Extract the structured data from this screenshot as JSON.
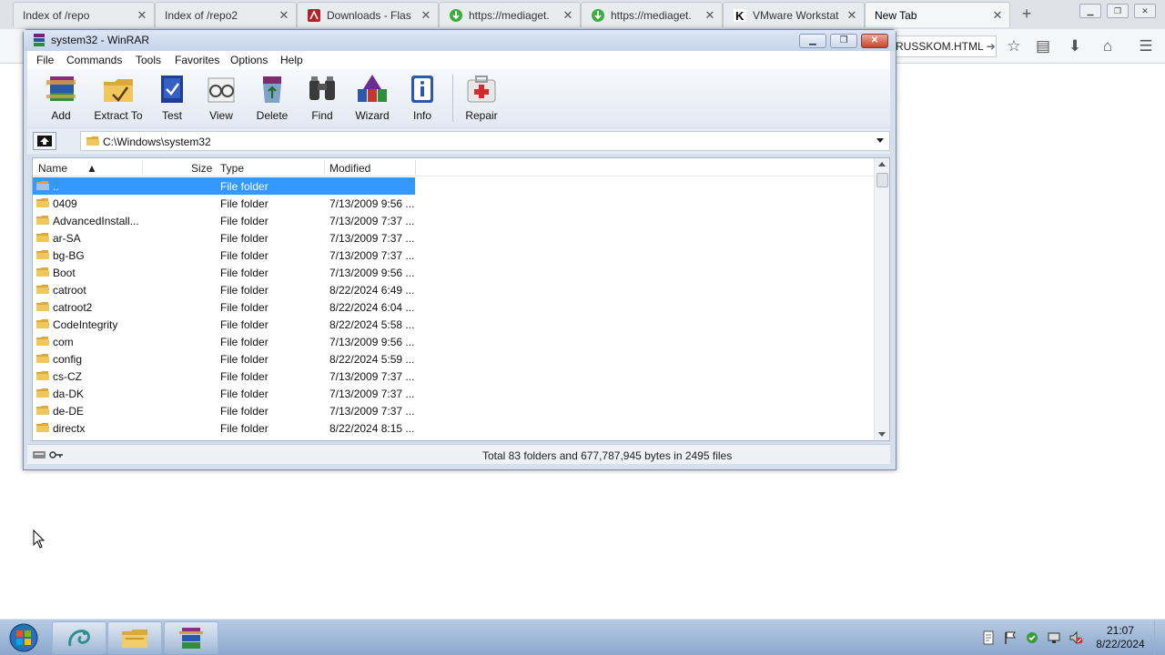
{
  "browser": {
    "tabs": [
      {
        "title": "Index of /repo",
        "icon": "none"
      },
      {
        "title": "Index of /repo2",
        "icon": "none"
      },
      {
        "title": "Downloads - Flas",
        "icon": "flash-icon"
      },
      {
        "title": "https://mediaget.",
        "icon": "mediaget-icon"
      },
      {
        "title": "https://mediaget.",
        "icon": "mediaget-icon"
      },
      {
        "title": "VMware Workstat",
        "icon": "k-icon"
      },
      {
        "title": "New Tab",
        "icon": "none",
        "active": true
      }
    ],
    "url_tail": "RUSSKOM.HTML"
  },
  "winrar": {
    "title": "system32 - WinRAR",
    "menu": [
      "File",
      "Commands",
      "Tools",
      "Favorites",
      "Options",
      "Help"
    ],
    "toolbar": [
      "Add",
      "Extract To",
      "Test",
      "View",
      "Delete",
      "Find",
      "Wizard",
      "Info",
      "Repair"
    ],
    "path": "C:\\Windows\\system32",
    "columns": {
      "name": "Name",
      "size": "Size",
      "type": "Type",
      "modified": "Modified"
    },
    "files": [
      {
        "name": "..",
        "type": "File folder",
        "modified": "",
        "selected": true
      },
      {
        "name": "0409",
        "type": "File folder",
        "modified": "7/13/2009 9:56 ..."
      },
      {
        "name": "AdvancedInstall...",
        "type": "File folder",
        "modified": "7/13/2009 7:37 ..."
      },
      {
        "name": "ar-SA",
        "type": "File folder",
        "modified": "7/13/2009 7:37 ..."
      },
      {
        "name": "bg-BG",
        "type": "File folder",
        "modified": "7/13/2009 7:37 ..."
      },
      {
        "name": "Boot",
        "type": "File folder",
        "modified": "7/13/2009 9:56 ..."
      },
      {
        "name": "catroot",
        "type": "File folder",
        "modified": "8/22/2024 6:49 ..."
      },
      {
        "name": "catroot2",
        "type": "File folder",
        "modified": "8/22/2024 6:04 ..."
      },
      {
        "name": "CodeIntegrity",
        "type": "File folder",
        "modified": "8/22/2024 5:58 ..."
      },
      {
        "name": "com",
        "type": "File folder",
        "modified": "7/13/2009 9:56 ..."
      },
      {
        "name": "config",
        "type": "File folder",
        "modified": "8/22/2024 5:59 ..."
      },
      {
        "name": "cs-CZ",
        "type": "File folder",
        "modified": "7/13/2009 7:37 ..."
      },
      {
        "name": "da-DK",
        "type": "File folder",
        "modified": "7/13/2009 7:37 ..."
      },
      {
        "name": "de-DE",
        "type": "File folder",
        "modified": "7/13/2009 7:37 ..."
      },
      {
        "name": "directx",
        "type": "File folder",
        "modified": "8/22/2024 8:15 ..."
      }
    ],
    "status": "Total 83 folders and 677,787,945 bytes in 2495 files"
  },
  "taskbar": {
    "clock_time": "21:07",
    "clock_date": "8/22/2024"
  },
  "colors": {
    "selection": "#3399ff",
    "taskbar": "#a5bcdb",
    "folder": "#e8b84a"
  }
}
